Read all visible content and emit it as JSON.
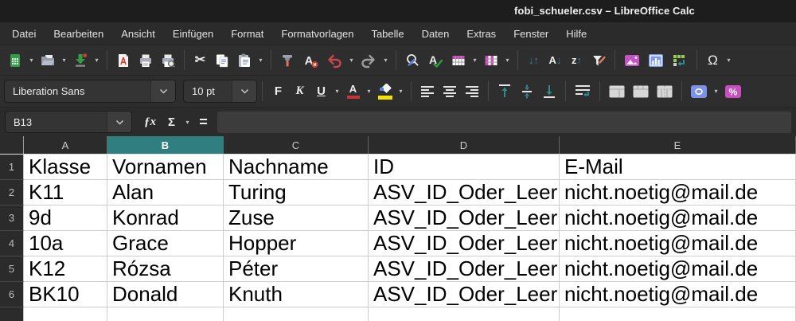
{
  "window": {
    "title": "fobi_schueler.csv – LibreOffice Calc"
  },
  "menubar": {
    "items": [
      "Datei",
      "Bearbeiten",
      "Ansicht",
      "Einfügen",
      "Format",
      "Formatvorlagen",
      "Tabelle",
      "Daten",
      "Extras",
      "Fenster",
      "Hilfe"
    ]
  },
  "toolbar_format": {
    "font_name": "Liberation Sans",
    "font_size": "10 pt"
  },
  "icons": {
    "cut": "✂",
    "clear_format_letter": "A",
    "spelling_letter": "A",
    "sort_arrows": "↓↑",
    "sort_asc_letter": "A",
    "sort_asc_arrow": "↓",
    "sort_desc_letter": "z",
    "sort_desc_arrow": "↑",
    "omega": "Ω",
    "bold": "F",
    "italic": "K",
    "underline": "U",
    "font_color_letter": "A",
    "percent": "%",
    "fx": "ƒx",
    "sigma": "Σ",
    "formula": "="
  },
  "formula_bar": {
    "cell_reference": "B13",
    "formula_value": ""
  },
  "sheet": {
    "column_headers": [
      "A",
      "B",
      "C",
      "D",
      "E"
    ],
    "selected_column": "B",
    "row_numbers": [
      1,
      2,
      3,
      4,
      5,
      6
    ],
    "rows": [
      [
        "Klasse",
        "Vornamen",
        "Nachname",
        "ID",
        "E-Mail"
      ],
      [
        "K11",
        "Alan",
        "Turing",
        "ASV_ID_Oder_Leer",
        "nicht.noetig@mail.de"
      ],
      [
        "9d",
        "Konrad",
        "Zuse",
        "ASV_ID_Oder_Leer",
        "nicht.noetig@mail.de"
      ],
      [
        "10a",
        "Grace",
        "Hopper",
        "ASV_ID_Oder_Leer",
        "nicht.noetig@mail.de"
      ],
      [
        "K12",
        "Rózsa",
        "Péter",
        "ASV_ID_Oder_Leer",
        "nicht.noetig@mail.de"
      ],
      [
        "BK10",
        "Donald",
        "Knuth",
        "ASV_ID_Oder_Leer",
        "nicht.noetig@mail.de"
      ]
    ]
  },
  "colors": {
    "selected_header": "#2f7e80",
    "accent_green": "#2f9e44",
    "accent_red": "#c5464f",
    "accent_magenta": "#c64bb6",
    "accent_blue": "#7b92e8",
    "accent_teal": "#2f8b8d",
    "highlight_yellow": "#f2e400",
    "cell_bg": "#ffffff",
    "ui_bg": "#2e2e2e"
  }
}
